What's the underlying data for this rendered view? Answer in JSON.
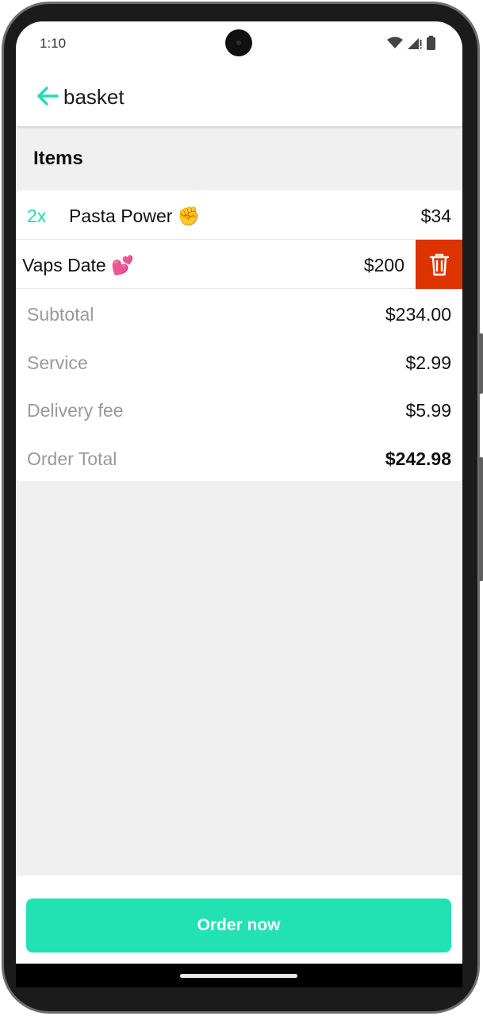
{
  "status_bar": {
    "time": "1:10",
    "icons": [
      "wifi-icon",
      "signal-icon",
      "battery-icon"
    ]
  },
  "app_bar": {
    "back_icon": "arrow-left-icon",
    "title": "basket"
  },
  "items_section": {
    "header": "Items",
    "items": [
      {
        "quantity": "2x",
        "name": "Pasta Power ✊",
        "price": "$34"
      },
      {
        "quantity": "",
        "name": "Vaps Date 💕",
        "price": "$200",
        "delete_icon": "trash-icon"
      }
    ]
  },
  "summary": {
    "rows": [
      {
        "label": "Subtotal",
        "value": "$234.00"
      },
      {
        "label": "Service",
        "value": "$2.99"
      },
      {
        "label": "Delivery fee",
        "value": "$5.99"
      },
      {
        "label": "Order Total",
        "value": "$242.98"
      }
    ]
  },
  "footer": {
    "order_button_label": "Order now"
  },
  "colors": {
    "accent": "#22e2b4",
    "delete": "#dd3300",
    "background": "#f0f0f0",
    "muted_text": "#999999"
  }
}
